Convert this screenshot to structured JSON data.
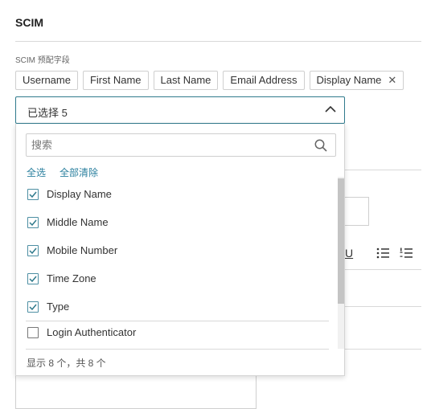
{
  "section": {
    "title": "SCIM"
  },
  "field": {
    "label": "SCIM 预配字段"
  },
  "chips": [
    {
      "label": "Username"
    },
    {
      "label": "First Name"
    },
    {
      "label": "Last Name"
    },
    {
      "label": "Email Address"
    },
    {
      "label": "Display Name",
      "removable": true
    }
  ],
  "select": {
    "value": "已选择 5",
    "icon": "chevron-up-icon"
  },
  "dropdown": {
    "search_placeholder": "搜索",
    "select_all": "全选",
    "clear_all": "全部清除",
    "items": [
      {
        "label": "Display Name",
        "checked": true
      },
      {
        "label": "Middle Name",
        "checked": true
      },
      {
        "label": "Mobile Number",
        "checked": true
      },
      {
        "label": "Time Zone",
        "checked": true
      },
      {
        "label": "Type",
        "checked": true
      },
      {
        "label": "Login Authenticator",
        "checked": false
      }
    ],
    "footer": "显示 8 个，共 8 个"
  },
  "colors": {
    "accent": "#2f7a8c",
    "link": "#2a7f9e",
    "border": "#cfcfcf"
  },
  "background_toolbar": {
    "underline": "U"
  }
}
